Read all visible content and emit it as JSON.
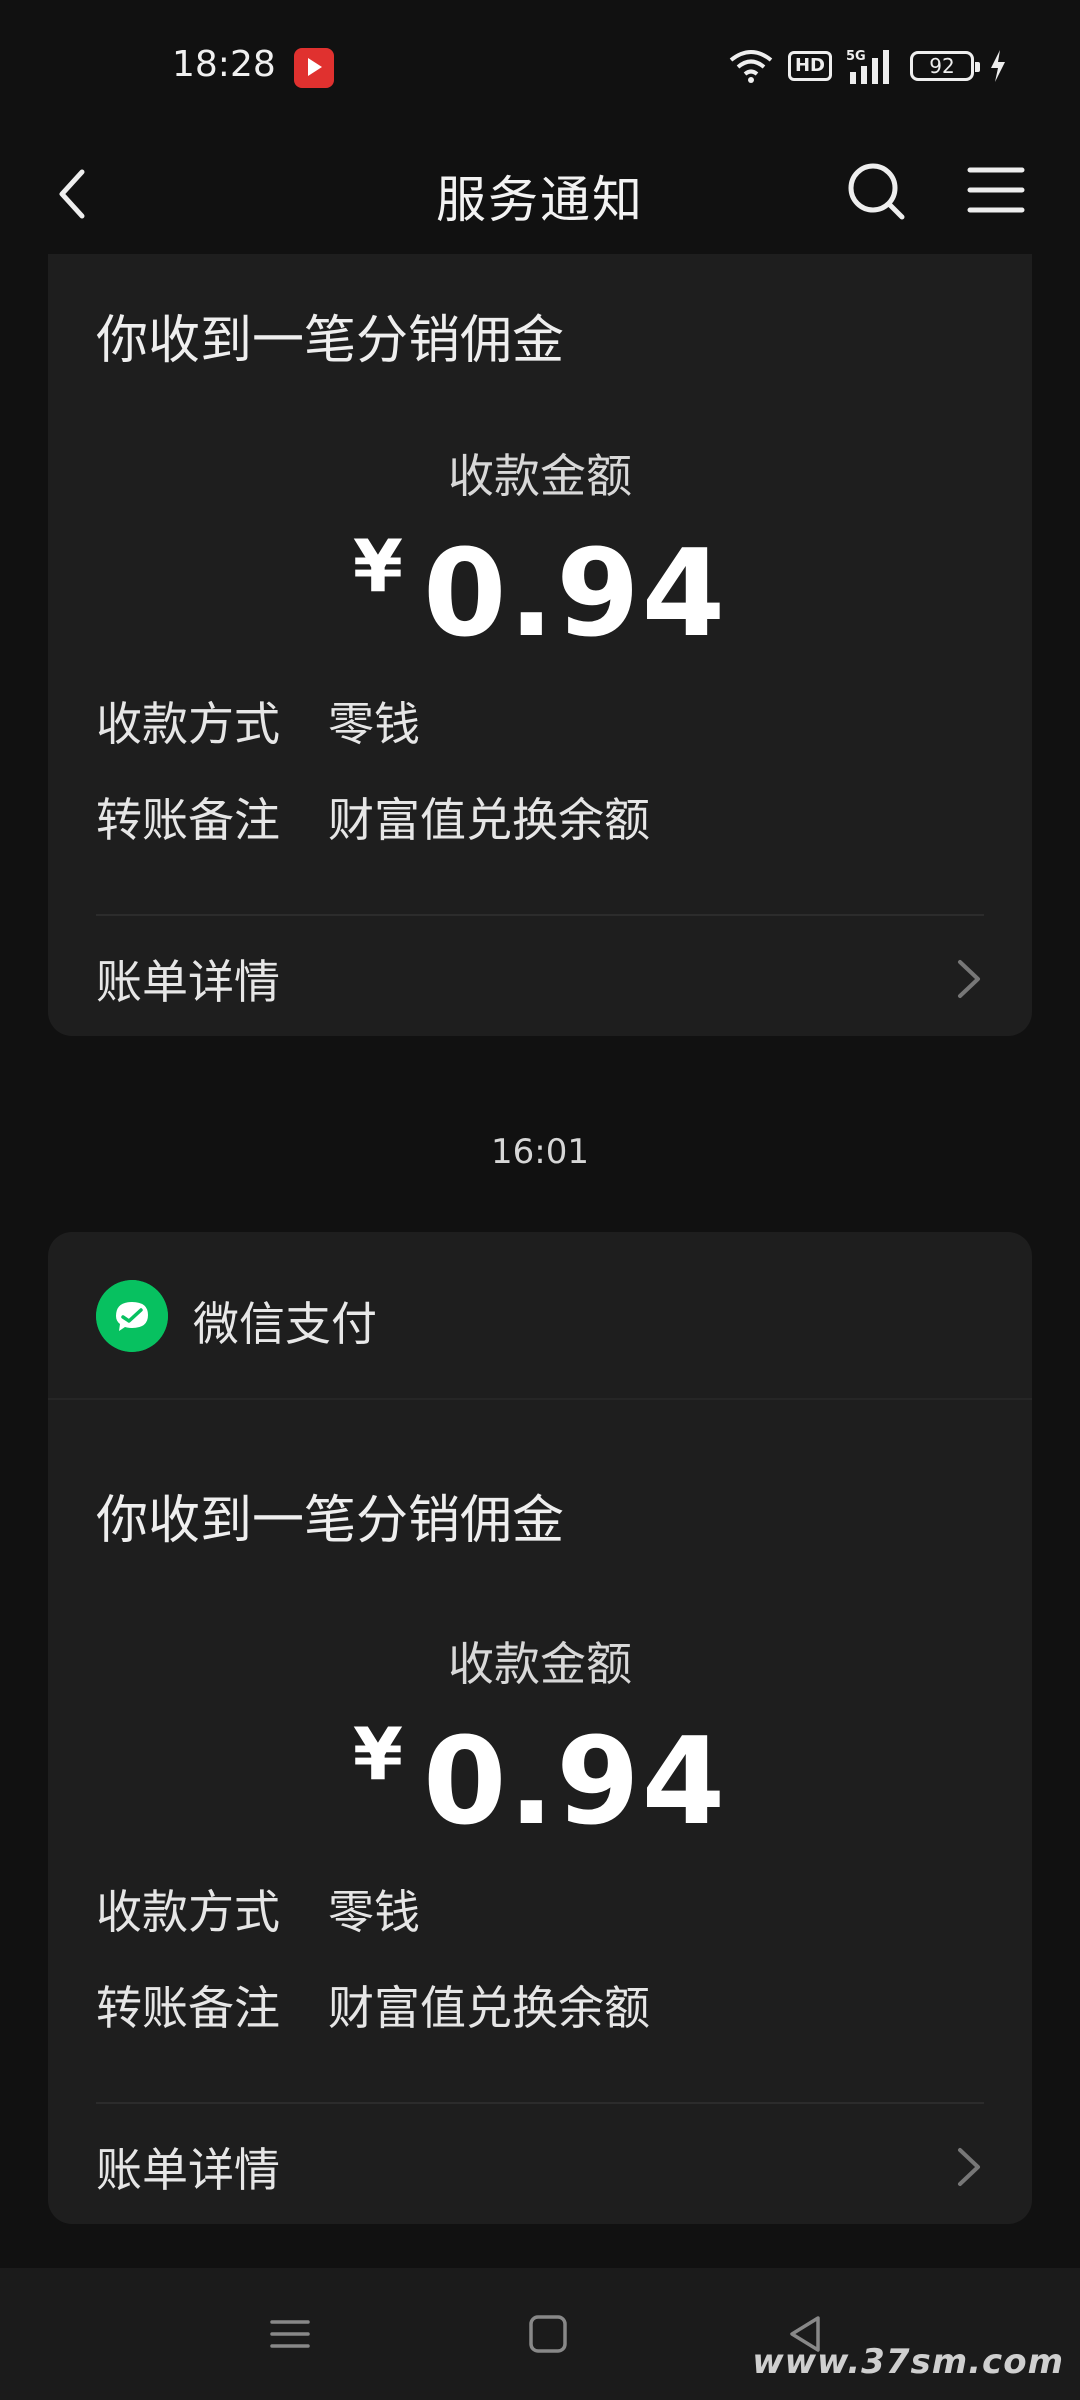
{
  "status_bar": {
    "time": "18:28",
    "network": "5G",
    "hd_label": "HD",
    "battery": "92",
    "icons": [
      "app-icon",
      "wifi-icon",
      "hd-icon",
      "signal-icon",
      "battery-icon",
      "charging-icon"
    ]
  },
  "navbar": {
    "title": "服务通知",
    "back_icon": "chevron-left-icon",
    "search_icon": "search-icon",
    "menu_icon": "menu-icon"
  },
  "cards": [
    {
      "title": "你收到一笔分销佣金",
      "amount_label": "收款金额",
      "currency": "¥",
      "amount": "0.94",
      "method_label": "收款方式",
      "method_value": "零钱",
      "note_label": "转账备注",
      "note_value": "财富值兑换余额",
      "detail_label": "账单详情"
    },
    {
      "sender": "微信支付",
      "title": "你收到一笔分销佣金",
      "amount_label": "收款金额",
      "currency": "¥",
      "amount": "0.94",
      "method_label": "收款方式",
      "method_value": "零钱",
      "note_label": "转账备注",
      "note_value": "财富值兑换余额",
      "detail_label": "账单详情"
    }
  ],
  "timestamp": "16:01",
  "watermark": "www.37sm.com",
  "colors": {
    "background": "#111111",
    "card": "#1e1e1e",
    "wechat_green": "#07c160"
  }
}
